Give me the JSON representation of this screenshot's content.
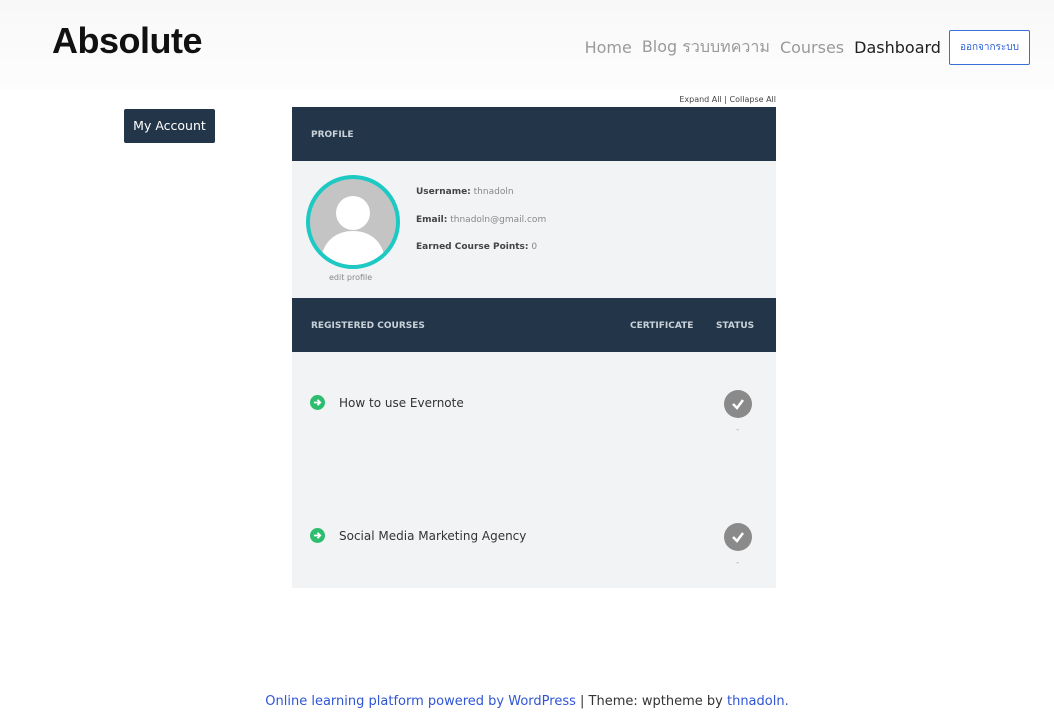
{
  "header": {
    "brand": "Absolute",
    "nav": [
      "Home",
      "Blog รวบบทความ",
      "Courses",
      "Dashboard"
    ],
    "logout": "ออกจากระบบ"
  },
  "sidebar": {
    "my_account": "My Account"
  },
  "controls": {
    "expand_all": "Expand All",
    "separator": "|",
    "collapse_all": "Collapse All"
  },
  "profile": {
    "section_title": "PROFILE",
    "username_label": "Username:",
    "username_value": "thnadoln",
    "email_label": "Email:",
    "email_value": "thnadoln@gmail.com",
    "points_label": "Earned Course Points:",
    "points_value": "0",
    "edit_profile": "edit profile"
  },
  "courses": {
    "section_title": "REGISTERED COURSES",
    "col_certificate": "CERTIFICATE",
    "col_status": "STATUS",
    "items": [
      {
        "name": "How to use Evernote",
        "certificate": "-"
      },
      {
        "name": "Social Media Marketing Agency",
        "certificate": "-"
      }
    ]
  },
  "footer": {
    "platform_link": "Online learning platform powered by WordPress",
    "separator": " | ",
    "theme_text": "Theme: wptheme by ",
    "author_link": "thnadoln."
  },
  "colors": {
    "bar": "#233649",
    "accent_teal": "#1cc9c3",
    "link_blue": "#2f55d4",
    "arrow_green": "#2dbd6e"
  }
}
